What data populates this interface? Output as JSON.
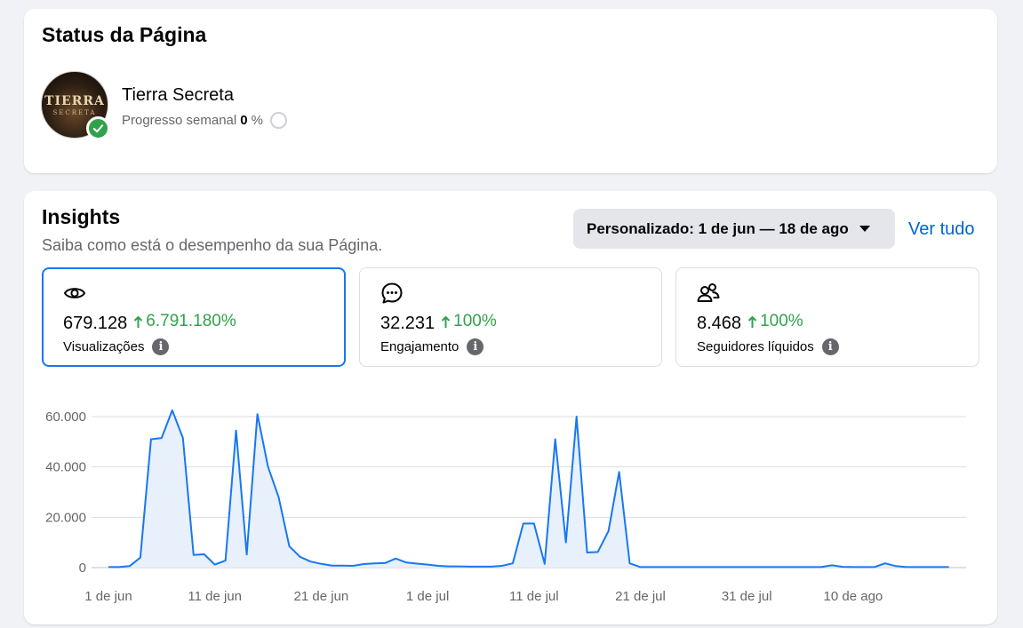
{
  "status": {
    "title": "Status da Página",
    "page_name": "Tierra Secreta",
    "avatar_text": "TIERRA",
    "avatar_subtext": "SECRETA",
    "progress_label": "Progresso semanal",
    "progress_value": "0",
    "progress_unit": "%"
  },
  "insights": {
    "title": "Insights",
    "subtitle": "Saiba como está o desempenho da sua Página.",
    "date_range": "Personalizado: 1 de jun — 18 de ago",
    "see_all": "Ver tudo",
    "metrics": [
      {
        "icon": "eye-icon",
        "value": "679.128",
        "change": "6.791.180%",
        "label": "Visualizações",
        "selected": true
      },
      {
        "icon": "comment-icon",
        "value": "32.231",
        "change": "100%",
        "label": "Engajamento",
        "selected": false
      },
      {
        "icon": "people-icon",
        "value": "8.468",
        "change": "100%",
        "label": "Seguidores líquidos",
        "selected": false
      }
    ]
  },
  "colors": {
    "accent": "#1877f2",
    "positive": "#31a24c",
    "link": "#0064d1",
    "line": "#1877f2",
    "area": "#e7f0fb"
  },
  "chart_data": {
    "type": "area",
    "title": "",
    "xlabel": "",
    "ylabel": "",
    "ylim": [
      0,
      60000
    ],
    "yticks": [
      0,
      20000,
      40000,
      60000
    ],
    "ytick_labels": [
      "0",
      "20.000",
      "40.000",
      "60.000"
    ],
    "xtick_labels": [
      "1 de jun",
      "11 de jun",
      "21 de jun",
      "1 de jul",
      "11 de jul",
      "21 de jul",
      "31 de jul",
      "10 de ago"
    ],
    "xtick_days": [
      0,
      10,
      20,
      30,
      40,
      50,
      60,
      70
    ],
    "grid": true,
    "series": [
      {
        "values": [
          200,
          200,
          600,
          4000,
          51000,
          51500,
          62500,
          51500,
          5000,
          5300,
          1200,
          2800,
          54500,
          5200,
          61000,
          40000,
          28000,
          8500,
          4300,
          2400,
          1500,
          800,
          800,
          700,
          1400,
          1700,
          1800,
          3600,
          2000,
          1600,
          1200,
          700,
          500,
          500,
          400,
          400,
          400,
          700,
          1700,
          17500,
          17500,
          1500,
          51000,
          10000,
          60000,
          6000,
          6200,
          14500,
          38000,
          1700,
          200,
          200,
          200,
          200,
          200,
          200,
          200,
          200,
          200,
          200,
          200,
          200,
          200,
          200,
          200,
          200,
          200,
          200,
          900,
          300,
          200,
          200,
          200,
          1700,
          600,
          200,
          200,
          200,
          200,
          200
        ]
      }
    ]
  }
}
